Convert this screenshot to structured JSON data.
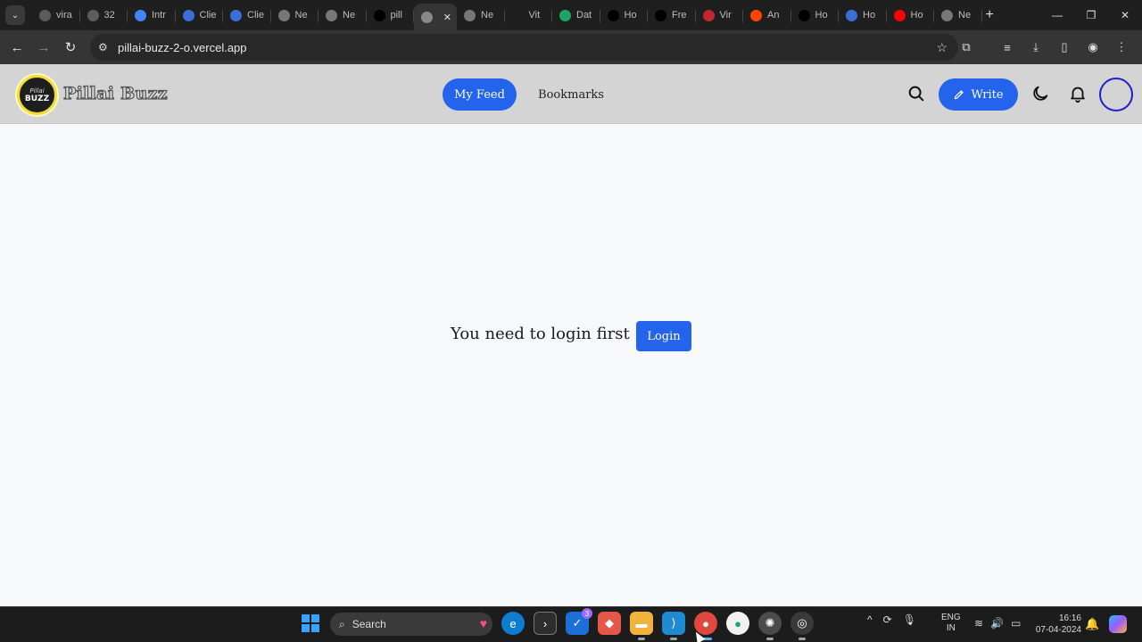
{
  "browser": {
    "tab_menu_icon": "chevron-down-icon",
    "tabs": [
      {
        "label": "vira",
        "favicon": "chatgpt-icon",
        "color": "#5c5c5c"
      },
      {
        "label": "32",
        "favicon": "chatgpt-icon",
        "color": "#5c5c5c"
      },
      {
        "label": "Intr",
        "favicon": "google-icon",
        "color": "#4285f4"
      },
      {
        "label": "Clie",
        "favicon": "api-icon",
        "color": "#3b6fd6"
      },
      {
        "label": "Clie",
        "favicon": "api-icon",
        "color": "#3b6fd6"
      },
      {
        "label": "Ne",
        "favicon": "chrome-icon",
        "color": "#777777"
      },
      {
        "label": "Ne",
        "favicon": "chrome-icon",
        "color": "#777777"
      },
      {
        "label": "pill",
        "favicon": "vercel-icon",
        "color": "#000000"
      },
      {
        "label": "",
        "favicon": "globe-icon",
        "color": "#888888",
        "active": true
      },
      {
        "label": "Ne",
        "favicon": "chrome-icon",
        "color": "#777777"
      },
      {
        "label": "Vit",
        "favicon": "vite-icon",
        "color": "#1f1f1f"
      },
      {
        "label": "Dat",
        "favicon": "mongodb-icon",
        "color": "#1fa463"
      },
      {
        "label": "Ho",
        "favicon": "x-icon",
        "color": "#000000"
      },
      {
        "label": "Fre",
        "favicon": "freecodecamp-icon",
        "color": "#000000"
      },
      {
        "label": "Vir",
        "favicon": "vercel-icon",
        "color": "#c1272d"
      },
      {
        "label": "An",
        "favicon": "reddit-icon",
        "color": "#ff4500"
      },
      {
        "label": "Ho",
        "favicon": "freecodecamp-icon",
        "color": "#000000"
      },
      {
        "label": "Ho",
        "favicon": "docs-icon",
        "color": "#3b6fd6"
      },
      {
        "label": "Ho",
        "favicon": "youtube-icon",
        "color": "#ff0000"
      },
      {
        "label": "Ne",
        "favicon": "chrome-icon",
        "color": "#777777"
      }
    ],
    "new_tab": "+",
    "url": "pillai-buzz-2-o.vercel.app"
  },
  "app": {
    "logo": {
      "line1": "Pillai",
      "line2": "BUZZ"
    },
    "brand": "Pillai Buzz",
    "nav": {
      "my_feed": "My Feed",
      "bookmarks": "Bookmarks"
    },
    "write_label": "Write",
    "accent": "#2463eb"
  },
  "main": {
    "message": "You need to login first",
    "login_label": "Login"
  },
  "taskbar": {
    "search_label": "Search",
    "badge_count": "3",
    "lang_top": "ENG",
    "lang_bottom": "IN",
    "time": "16:16",
    "date": "07-04-2024"
  }
}
